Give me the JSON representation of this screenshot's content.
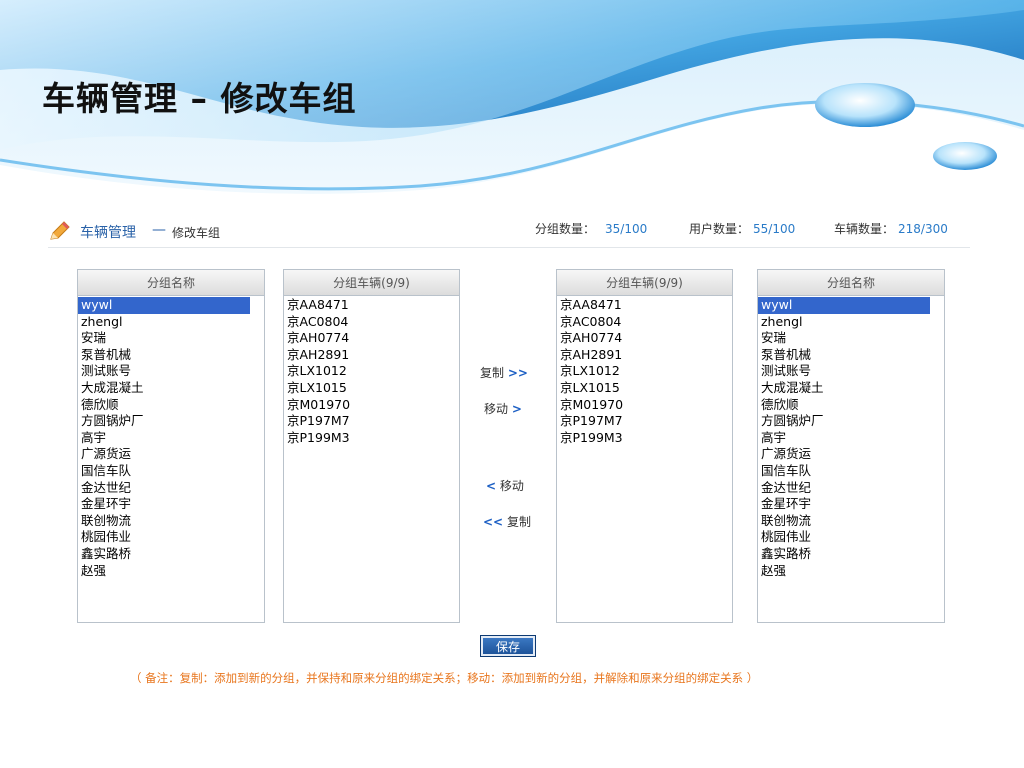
{
  "slide": {
    "title": "车辆管理 – 修改车组"
  },
  "breadcrumb": {
    "main": "车辆管理",
    "separator": "—",
    "sub": "修改车组"
  },
  "stats": [
    {
      "label": "分组数量：",
      "value": "35/100"
    },
    {
      "label": "用户数量：",
      "value": "55/100"
    },
    {
      "label": "车辆数量：",
      "value": "218/300"
    }
  ],
  "panels": {
    "left_groups": {
      "header": "分组名称",
      "items": [
        "wywl",
        "zhengl",
        "安瑞",
        "泵普机械",
        "测试账号",
        "大成混凝土",
        "德欣顺",
        "方圆锅炉厂",
        "高宇",
        "广源货运",
        "国信车队",
        "金达世纪",
        "金星环宇",
        "联创物流",
        "桃园伟业",
        "鑫实路桥",
        "赵强"
      ],
      "selected": "wywl"
    },
    "left_vehicles": {
      "header": "分组车辆(9/9)",
      "items": [
        "京AA8471",
        "京AC0804",
        "京AH0774",
        "京AH2891",
        "京LX1012",
        "京LX1015",
        "京M01970",
        "京P197M7",
        "京P199M3"
      ]
    },
    "right_vehicles": {
      "header": "分组车辆(9/9)",
      "items": [
        "京AA8471",
        "京AC0804",
        "京AH0774",
        "京AH2891",
        "京LX1012",
        "京LX1015",
        "京M01970",
        "京P197M7",
        "京P199M3"
      ]
    },
    "right_groups": {
      "header": "分组名称",
      "items": [
        "wywl",
        "zhengl",
        "安瑞",
        "泵普机械",
        "测试账号",
        "大成混凝土",
        "德欣顺",
        "方圆锅炉厂",
        "高宇",
        "广源货运",
        "国信车队",
        "金达世纪",
        "金星环宇",
        "联创物流",
        "桃园伟业",
        "鑫实路桥",
        "赵强"
      ],
      "selected": "wywl"
    }
  },
  "actions": {
    "copy_right_label": "复制",
    "copy_right_arrow": ">>",
    "move_right_label": "移动",
    "move_right_arrow": ">",
    "move_left_arrow": "<",
    "move_left_label": "移动",
    "copy_left_arrow": "<<",
    "copy_left_label": "复制"
  },
  "save_label": "保存",
  "note": "（ 备注：复制：添加到新的分组，并保持和原来分组的绑定关系；移动：添加到新的分组，并解除和原来分组的绑定关系 ）",
  "colors": {
    "accent": "#2a62a8",
    "selection": "#3366cc",
    "note": "#e8761e",
    "stat_value": "#2a7bc8"
  }
}
